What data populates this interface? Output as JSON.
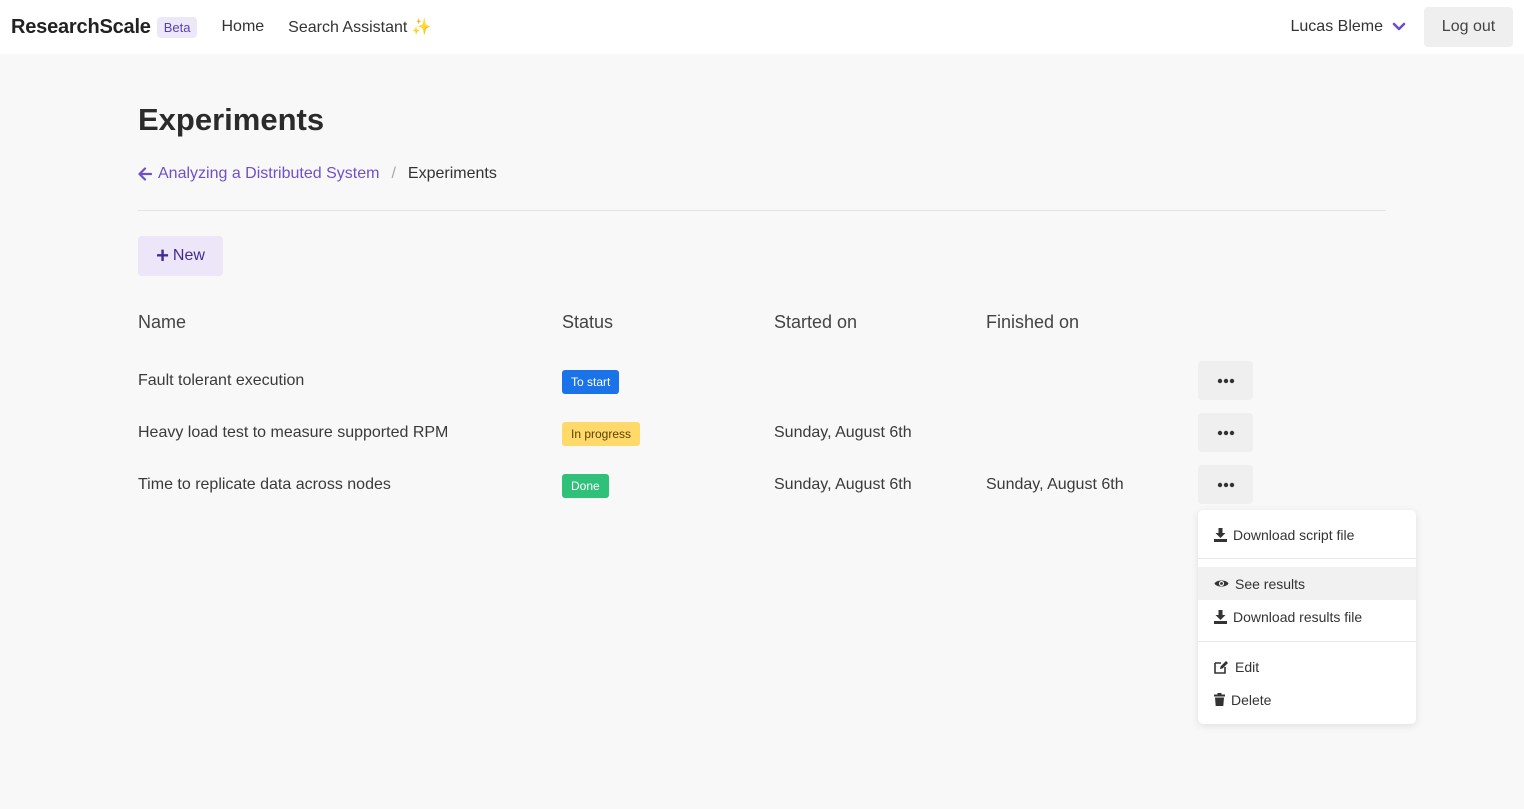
{
  "nav": {
    "brand": "ResearchScale",
    "badge": "Beta",
    "links": [
      "Home",
      "Search Assistant"
    ],
    "sparkle": "✨",
    "user": "Lucas Bleme",
    "logout": "Log out"
  },
  "page": {
    "title": "Experiments",
    "breadcrumb_parent": "Analyzing a Distributed System",
    "breadcrumb_separator": "/",
    "breadcrumb_current": "Experiments",
    "new_button": "New"
  },
  "table": {
    "headers": [
      "Name",
      "Status",
      "Started on",
      "Finished on"
    ],
    "rows": [
      {
        "name": "Fault tolerant execution",
        "status": "To start",
        "status_color": "#1a73e8",
        "started": "",
        "finished": ""
      },
      {
        "name": "Heavy load test to measure supported RPM",
        "status": "In progress",
        "status_color": "#ffd96a",
        "started": "Sunday, August 6th",
        "finished": ""
      },
      {
        "name": "Time to replicate data across nodes",
        "status": "Done",
        "status_color": "#2fc07a",
        "started": "Sunday, August 6th",
        "finished": "Sunday, August 6th"
      }
    ]
  },
  "menu": {
    "items": [
      {
        "label": "Download script file",
        "icon": "download-icon"
      },
      {
        "label": "See results",
        "icon": "eye-icon"
      },
      {
        "label": "Download results file",
        "icon": "download-icon"
      },
      {
        "label": "Edit",
        "icon": "edit-icon"
      },
      {
        "label": "Delete",
        "icon": "trash-icon"
      }
    ]
  },
  "colors": {
    "accent": "#7050c9",
    "background": "#f8f8f8"
  }
}
